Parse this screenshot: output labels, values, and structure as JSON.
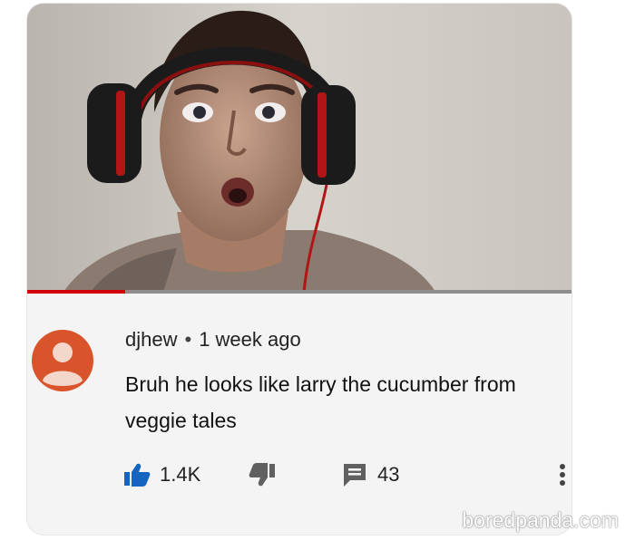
{
  "comment": {
    "username": "djhew",
    "separator": "•",
    "time": "1 week ago",
    "text": "Bruh he looks like larry the cucumber from veggie tales"
  },
  "actions": {
    "like_count": "1.4K",
    "reply_count": "43"
  },
  "video": {
    "progress_fraction": 0.18
  },
  "colors": {
    "avatar": "#d9542b",
    "like_active": "#1565c0",
    "progress": "#d40000"
  },
  "icons": {
    "like": "thumbs-up-icon",
    "dislike": "thumbs-down-icon",
    "reply": "comment-icon",
    "more": "more-vertical-icon"
  },
  "watermark": "boredpanda.com"
}
